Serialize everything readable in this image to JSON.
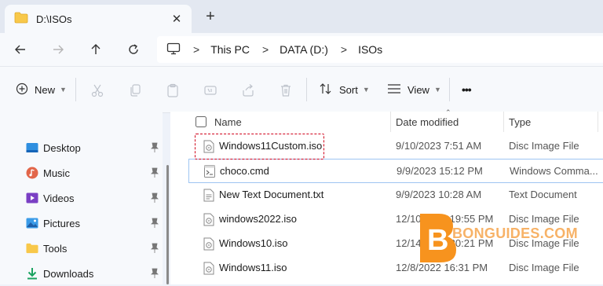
{
  "tab": {
    "title": "D:\\ISOs",
    "close": "✕",
    "new_tab": "+"
  },
  "address": {
    "crumbs": [
      "This PC",
      "DATA (D:)",
      "ISOs"
    ],
    "sep": ">"
  },
  "toolbar": {
    "new_label": "New",
    "sort_label": "Sort",
    "view_label": "View",
    "more_label": "•••"
  },
  "sidebar": {
    "items": [
      {
        "label": "Desktop",
        "icon": "desktop-icon"
      },
      {
        "label": "Music",
        "icon": "music-icon"
      },
      {
        "label": "Videos",
        "icon": "videos-icon"
      },
      {
        "label": "Pictures",
        "icon": "pictures-icon"
      },
      {
        "label": "Tools",
        "icon": "folder-icon"
      },
      {
        "label": "Downloads",
        "icon": "download-icon"
      }
    ]
  },
  "columns": {
    "name": "Name",
    "date": "Date modified",
    "type": "Type"
  },
  "files": [
    {
      "name": "Windows11Custom.iso",
      "date": "9/10/2023 7:51 AM",
      "type": "Disc Image File",
      "icon": "disc-image-file-icon"
    },
    {
      "name": "choco.cmd",
      "date": "9/9/2023 15:12 PM",
      "type": "Windows Comma...",
      "icon": "script-file-icon"
    },
    {
      "name": "New Text Document.txt",
      "date": "9/9/2023 10:28 AM",
      "type": "Text Document",
      "icon": "text-file-icon"
    },
    {
      "name": "windows2022.iso",
      "date": "12/10/2022 19:55 PM",
      "type": "Disc Image File",
      "icon": "disc-image-file-icon"
    },
    {
      "name": "Windows10.iso",
      "date": "12/14/2022 20:21 PM",
      "type": "Disc Image File",
      "icon": "disc-image-file-icon"
    },
    {
      "name": "Windows11.iso",
      "date": "12/8/2022 16:31 PM",
      "type": "Disc Image File",
      "icon": "disc-image-file-icon"
    }
  ],
  "watermark": {
    "text": "BONGUIDES.COM",
    "letter": "B"
  },
  "colors": {
    "highlight_border": "#d0021b",
    "selection_border": "#9ec5f2",
    "brand_orange": "#f7931e"
  }
}
